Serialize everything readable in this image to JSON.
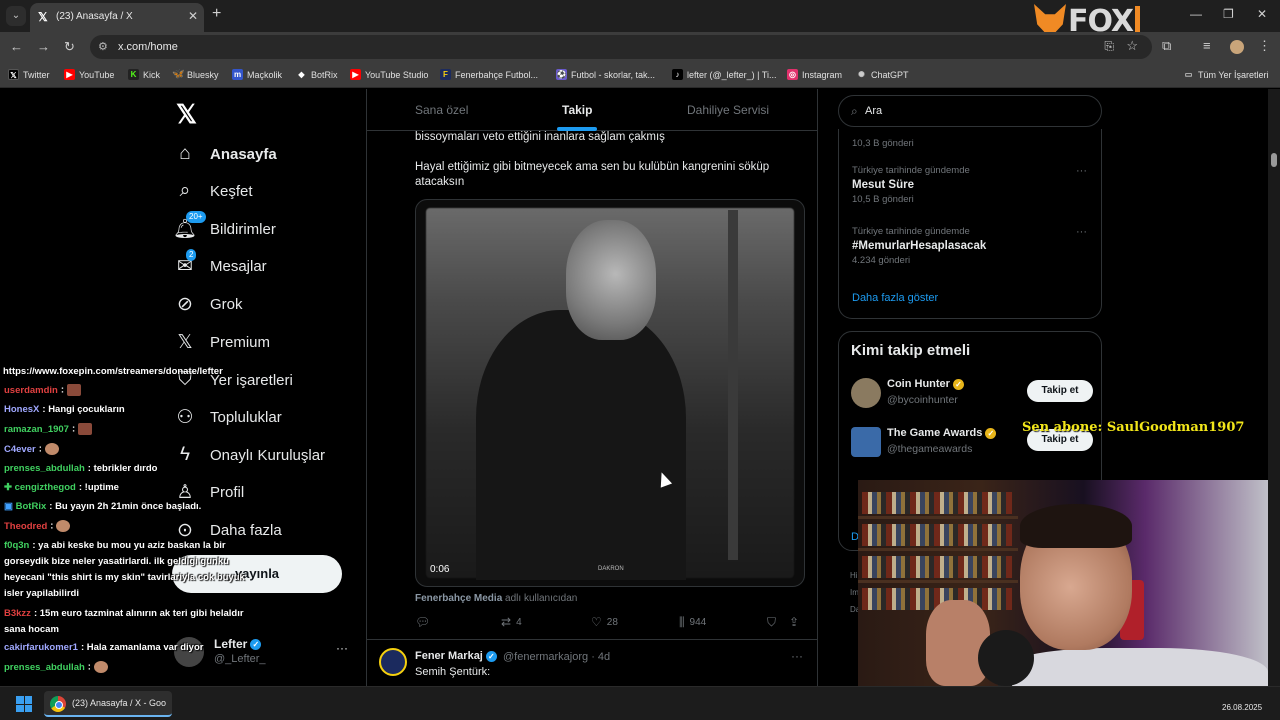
{
  "browser": {
    "tab_title": "(23) Anasayfa / X",
    "url": "x.com/home",
    "overlay_logo_text": "FOX",
    "bookmarks": [
      {
        "label": "Twitter",
        "icon": "x-icon",
        "color": "#000000"
      },
      {
        "label": "YouTube",
        "icon": "youtube-icon",
        "color": "#ff0000"
      },
      {
        "label": "Kick",
        "icon": "kick-icon",
        "color": "#53fc18"
      },
      {
        "label": "Bluesky",
        "icon": "bluesky-icon",
        "color": "#1185fe"
      },
      {
        "label": "Maçkolik",
        "icon": "mackolik-icon",
        "color": "#3355cc"
      },
      {
        "label": "BotRix",
        "icon": "botrix-icon",
        "color": "#ffffff"
      },
      {
        "label": "YouTube Studio",
        "icon": "youtube-studio-icon",
        "color": "#ff0000"
      },
      {
        "label": "Fenerbahçe Futbol...",
        "icon": "fenerbahce-icon",
        "color": "#1b2a5e"
      },
      {
        "label": "Futbol - skorlar, tak...",
        "icon": "futbol-icon",
        "color": "#6a5acd"
      },
      {
        "label": "lefter (@_lefter_) | Ti...",
        "icon": "tiktok-icon",
        "color": "#000000"
      },
      {
        "label": "Instagram",
        "icon": "instagram-icon",
        "color": "#e1306c"
      },
      {
        "label": "ChatGPT",
        "icon": "chatgpt-icon",
        "color": "#888888"
      }
    ],
    "all_bookmarks_label": "Tüm Yer İşaretleri"
  },
  "nav": {
    "items": [
      {
        "label": "Anasayfa",
        "icon": "home-icon",
        "bold": true
      },
      {
        "label": "Keşfet",
        "icon": "search-icon"
      },
      {
        "label": "Bildirimler",
        "icon": "bell-icon",
        "badge": "20+"
      },
      {
        "label": "Mesajlar",
        "icon": "mail-icon",
        "badge": "2"
      },
      {
        "label": "Grok",
        "icon": "grok-icon"
      },
      {
        "label": "Premium",
        "icon": "x-premium-icon"
      },
      {
        "label": "Yer işaretleri",
        "icon": "bookmark-icon"
      },
      {
        "label": "Topluluklar",
        "icon": "communities-icon"
      },
      {
        "label": "Onaylı Kuruluşlar",
        "icon": "lightning-icon"
      },
      {
        "label": "Profil",
        "icon": "person-icon"
      },
      {
        "label": "Daha fazla",
        "icon": "more-circle-icon"
      }
    ],
    "post_button": "yayınla",
    "account": {
      "name": "Lefter",
      "handle": "@_Lefter_"
    }
  },
  "feed": {
    "tabs": [
      "Sana özel",
      "Takip",
      "Dahiliye Servisi"
    ],
    "active_tab": "Takip",
    "tweet": {
      "text_line1": "bissoymaları veto ettiğini inanlara sağlam çakmış",
      "text_para2": "Hayal ettiğimiz gibi bitmeyecek ama sen bu kulübün kangrenini söküp atacaksın",
      "video_time": "0:06",
      "video_watermark": "DAKRON",
      "source_name": "Fenerbahçe Media",
      "source_suffix": "adlı kullanıcıdan",
      "retweets": "4",
      "likes": "28",
      "views": "944"
    },
    "next_tweet": {
      "name": "Fener Markaj",
      "handle": "@fenermarkajorg · 4d",
      "text": "Semih Şentürk:"
    }
  },
  "right": {
    "search_placeholder": "Ara",
    "trends": [
      {
        "category": "",
        "name": "",
        "count": "10,3 B gönderi"
      },
      {
        "category": "Türkiye tarihinde gündemde",
        "name": "Mesut Süre",
        "count": "10,5 B gönderi"
      },
      {
        "category": "Türkiye tarihinde gündemde",
        "name": "#MemurlarHesaplasacak",
        "count": "4.234 gönderi"
      }
    ],
    "show_more": "Daha fazla göster",
    "who_to_follow": {
      "title": "Kimi takip etmeli",
      "accounts": [
        {
          "name": "Coin Hunter",
          "handle": "@bycoinhunter",
          "button": "Takip et"
        },
        {
          "name": "The Game Awards",
          "handle": "@thegameawards",
          "button": "Takip et"
        }
      ],
      "link": "Da"
    },
    "footer_fragments": [
      "Hi",
      "Im",
      "Da"
    ]
  },
  "chat": {
    "donate_url": "https://www.foxepin.com/streamers/donate/lefter",
    "messages": [
      {
        "user": "userdamdin",
        "color": "#e04040",
        "text": "",
        "emote": true
      },
      {
        "user": "HonesX",
        "color": "#a0a8ff",
        "text": "Hangi çocukların"
      },
      {
        "user": "ramazan_1907",
        "color": "#40d060",
        "text": "",
        "emote": true
      },
      {
        "user": "C4ever",
        "color": "#a0a8ff",
        "text": "",
        "emote": true
      },
      {
        "user": "prenses_abdullah",
        "color": "#40d060",
        "text": "tebrikler dırdo"
      },
      {
        "user": "cengizthegod",
        "color": "#40d060",
        "text": "!uptime"
      },
      {
        "user": "BotRix",
        "color": "#40d060",
        "text": "Bu yayın 2h 21min önce başladı."
      },
      {
        "user": "Theodred",
        "color": "#e04040",
        "text": "",
        "emote": true
      },
      {
        "user": "f0q3n",
        "color": "#40d060",
        "text": "ya abi keske bu mou yu aziz baskan la bir gorseydik bize neler yasatirlardi. ilk geldigi gunku heyecani \"this shirt is my skin\" tavirlariyla cok buyuk isler yapilabilirdi"
      },
      {
        "user": "B3kzz",
        "color": "#e04040",
        "text": "15m euro tazminat alınırın ak teri gibi helaldır sana hocam"
      },
      {
        "user": "cakirfarukomer1",
        "color": "#a0a8ff",
        "text": "Hala zamanlama var diyor"
      },
      {
        "user": "prenses_abdullah",
        "color": "#40d060",
        "text": "",
        "emote": true
      }
    ]
  },
  "stream_overlay": {
    "sen_abone": "Sen abone: SaulGoodman1907"
  },
  "taskbar": {
    "app_title": "(23) Anasayfa / X - Goo",
    "date": "26.08.2025"
  }
}
